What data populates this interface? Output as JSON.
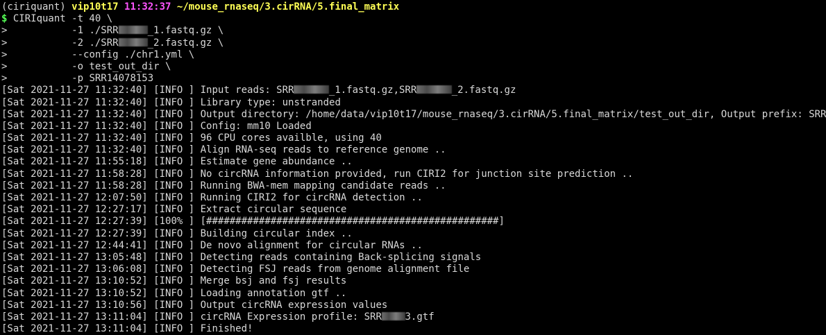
{
  "prompt": {
    "env": "(ciriquant)",
    "user": "vip10t17",
    "time": "11:32:37",
    "path": "~/mouse_rnaseq/3.cirRNA/5.final_matrix",
    "symbol": "$"
  },
  "command": [
    {
      "prefix": "$ ",
      "segments": [
        {
          "t": "CIRIquant -t 40 \\"
        }
      ]
    },
    {
      "prefix": ">",
      "segments": [
        {
          "t": "           -1 ./SRR"
        },
        {
          "redact": 5
        },
        {
          "t": "_1.fastq.gz \\"
        }
      ]
    },
    {
      "prefix": ">",
      "segments": [
        {
          "t": "           -2 ./SRR"
        },
        {
          "redact": 5
        },
        {
          "t": "_2.fastq.gz \\"
        }
      ]
    },
    {
      "prefix": ">",
      "segments": [
        {
          "t": "           --config ./chr1.yml \\"
        }
      ]
    },
    {
      "prefix": ">",
      "segments": [
        {
          "t": "           -o test_out_dir \\"
        }
      ]
    },
    {
      "prefix": ">",
      "segments": [
        {
          "t": "           -p SRR14078153"
        }
      ]
    }
  ],
  "log": [
    {
      "ts": "[Sat 2021-11-27 11:32:40]",
      "level": "[INFO ]",
      "segments": [
        {
          "t": "Input reads: SRR"
        },
        {
          "redact": 6
        },
        {
          "t": "_1.fastq.gz,SRR"
        },
        {
          "redact": 6
        },
        {
          "t": "_2.fastq.gz"
        }
      ]
    },
    {
      "ts": "[Sat 2021-11-27 11:32:40]",
      "level": "[INFO ]",
      "segments": [
        {
          "t": "Library type: unstranded"
        }
      ]
    },
    {
      "ts": "[Sat 2021-11-27 11:32:40]",
      "level": "[INFO ]",
      "segments": [
        {
          "t": "Output directory: /home/data/vip10t17/mouse_rnaseq/3.cirRNA/5.final_matrix/test_out_dir, Output prefix: SRR"
        },
        {
          "redact": 5
        }
      ]
    },
    {
      "ts": "[Sat 2021-11-27 11:32:40]",
      "level": "[INFO ]",
      "segments": [
        {
          "t": "Config: mm10 Loaded"
        }
      ]
    },
    {
      "ts": "[Sat 2021-11-27 11:32:40]",
      "level": "[INFO ]",
      "segments": [
        {
          "t": "96 CPU cores availble, using 40"
        }
      ]
    },
    {
      "ts": "[Sat 2021-11-27 11:32:40]",
      "level": "[INFO ]",
      "segments": [
        {
          "t": "Align RNA-seq reads to reference genome .."
        }
      ]
    },
    {
      "ts": "[Sat 2021-11-27 11:55:18]",
      "level": "[INFO ]",
      "segments": [
        {
          "t": "Estimate gene abundance .."
        }
      ]
    },
    {
      "ts": "[Sat 2021-11-27 11:58:28]",
      "level": "[INFO ]",
      "segments": [
        {
          "t": "No circRNA information provided, run CIRI2 for junction site prediction .."
        }
      ]
    },
    {
      "ts": "[Sat 2021-11-27 11:58:28]",
      "level": "[INFO ]",
      "segments": [
        {
          "t": "Running BWA-mem mapping candidate reads .."
        }
      ]
    },
    {
      "ts": "[Sat 2021-11-27 12:07:50]",
      "level": "[INFO ]",
      "segments": [
        {
          "t": "Running CIRI2 for circRNA detection .."
        }
      ]
    },
    {
      "ts": "[Sat 2021-11-27 12:27:17]",
      "level": "[INFO ]",
      "segments": [
        {
          "t": "Extract circular sequence"
        }
      ]
    },
    {
      "ts": "[Sat 2021-11-27 12:27:39]",
      "level": "[100% ]",
      "segments": [
        {
          "t": "[##################################################]"
        }
      ]
    },
    {
      "ts": "[Sat 2021-11-27 12:27:39]",
      "level": "[INFO ]",
      "segments": [
        {
          "t": "Building circular index .."
        }
      ]
    },
    {
      "ts": "[Sat 2021-11-27 12:44:41]",
      "level": "[INFO ]",
      "segments": [
        {
          "t": "De novo alignment for circular RNAs .."
        }
      ]
    },
    {
      "ts": "[Sat 2021-11-27 13:05:48]",
      "level": "[INFO ]",
      "segments": [
        {
          "t": "Detecting reads containing Back-splicing signals"
        }
      ]
    },
    {
      "ts": "[Sat 2021-11-27 13:06:08]",
      "level": "[INFO ]",
      "segments": [
        {
          "t": "Detecting FSJ reads from genome alignment file"
        }
      ]
    },
    {
      "ts": "[Sat 2021-11-27 13:10:52]",
      "level": "[INFO ]",
      "segments": [
        {
          "t": "Merge bsj and fsj results"
        }
      ]
    },
    {
      "ts": "[Sat 2021-11-27 13:10:52]",
      "level": "[INFO ]",
      "segments": [
        {
          "t": "Loading annotation gtf .."
        }
      ]
    },
    {
      "ts": "[Sat 2021-11-27 13:10:56]",
      "level": "[INFO ]",
      "segments": [
        {
          "t": "Output circRNA expression values"
        }
      ]
    },
    {
      "ts": "[Sat 2021-11-27 13:11:04]",
      "level": "[INFO ]",
      "segments": [
        {
          "t": "circRNA Expression profile: SRR"
        },
        {
          "redact": 4
        },
        {
          "t": "3.gtf"
        }
      ]
    },
    {
      "ts": "[Sat 2021-11-27 13:11:04]",
      "level": "[INFO ]",
      "segments": [
        {
          "t": "Finished!"
        }
      ]
    }
  ],
  "colors": {
    "background": "#000000",
    "text": "#d9d9d9",
    "user": "#ffff55",
    "time": "#ff55ff",
    "path": "#ffff55",
    "dollar": "#55ff55"
  }
}
